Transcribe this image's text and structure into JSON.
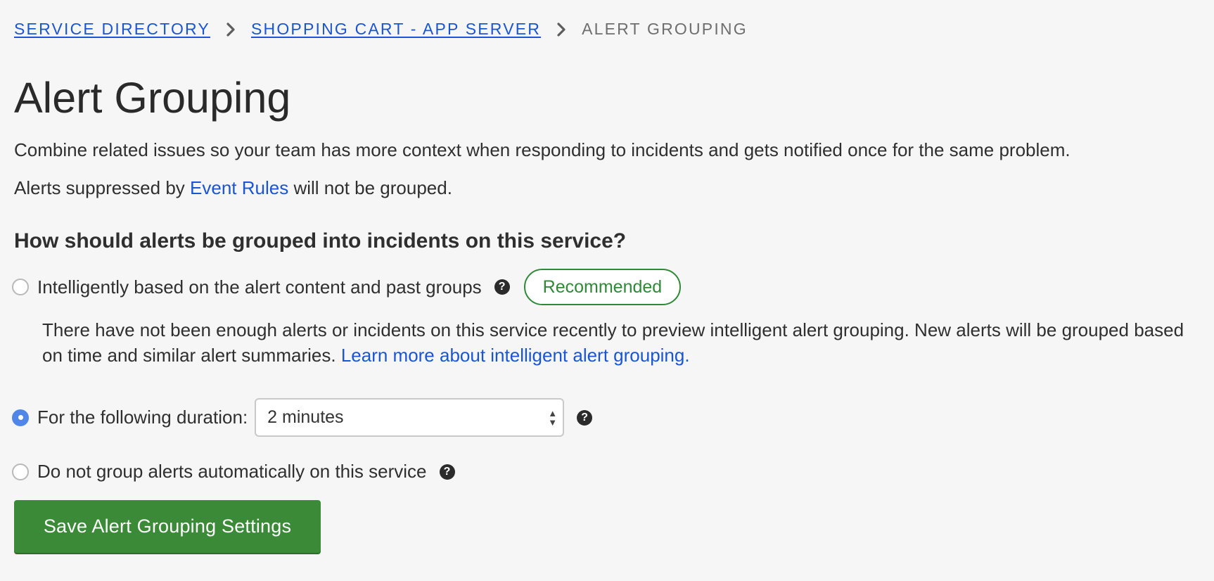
{
  "breadcrumb": {
    "items": [
      {
        "label": "SERVICE DIRECTORY"
      },
      {
        "label": "SHOPPING CART - APP SERVER"
      },
      {
        "label": "ALERT GROUPING"
      }
    ]
  },
  "page": {
    "title": "Alert Grouping",
    "description": "Combine related issues so your team has more context when responding to incidents and gets notified once for the same problem.",
    "suppressed_prefix": "Alerts suppressed by",
    "suppressed_link": "Event Rules",
    "suppressed_suffix": "will not be grouped."
  },
  "question": "How should alerts be grouped into incidents on this service?",
  "options": {
    "intelligent": {
      "label": "Intelligently based on the alert content and past groups",
      "checked": false,
      "badge": "Recommended",
      "note": "There have not been enough alerts or incidents on this service recently to preview intelligent alert grouping. New alerts will be grouped based on time and similar alert summaries.",
      "learn_more": "Learn more about intelligent alert grouping."
    },
    "duration": {
      "label": "For the following duration:",
      "checked": true,
      "selected_value": "2 minutes"
    },
    "none": {
      "label": "Do not group alerts automatically on this service",
      "checked": false
    }
  },
  "save_button": "Save Alert Grouping Settings",
  "icons": {
    "chevron": "chevron-right-icon",
    "help": "question-circle-icon",
    "select": "select-updown-arrows-icon"
  },
  "colors": {
    "link": "#1a55d4",
    "badge_green": "#2e8a36",
    "button_green": "#3a8a37",
    "radio_checked": "#4f86e8",
    "background": "#f6f6f6"
  }
}
